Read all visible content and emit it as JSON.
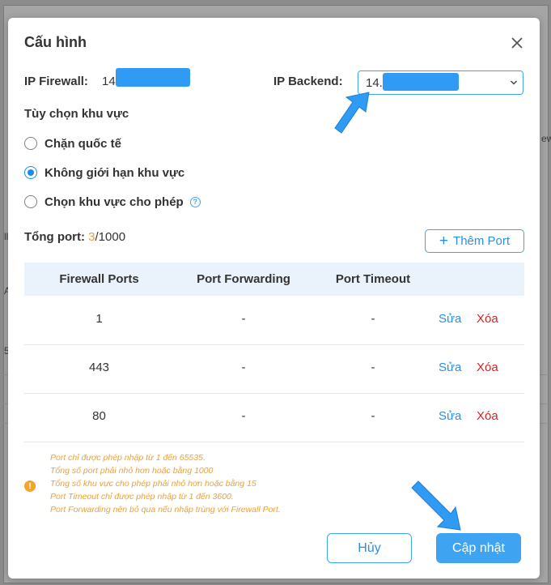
{
  "background": {
    "fragments": [
      "ew",
      "ll",
      "A",
      "5"
    ]
  },
  "modal": {
    "title": "Cấu hình",
    "close_icon": "close-icon"
  },
  "ip": {
    "firewall_label": "IP Firewall:",
    "firewall_value": "14",
    "backend_label": "IP Backend:",
    "backend_value": "14."
  },
  "region": {
    "label": "Tùy chọn khu vực",
    "options": [
      {
        "label": "Chặn quốc tế",
        "checked": false
      },
      {
        "label": "Không giới hạn khu vực",
        "checked": true
      },
      {
        "label": "Chọn khu vực cho phép",
        "checked": false,
        "help": "?"
      }
    ]
  },
  "ports": {
    "total_label": "Tổng port:",
    "current": "3",
    "max": "/1000",
    "add_button": "Thêm Port",
    "columns": [
      "Firewall Ports",
      "Port Forwarding",
      "Port Timeout"
    ],
    "rows": [
      {
        "firewall": "1",
        "forwarding": "-",
        "timeout": "-",
        "edit": "Sửa",
        "delete": "Xóa"
      },
      {
        "firewall": "443",
        "forwarding": "-",
        "timeout": "-",
        "edit": "Sửa",
        "delete": "Xóa"
      },
      {
        "firewall": "80",
        "forwarding": "-",
        "timeout": "-",
        "edit": "Sửa",
        "delete": "Xóa"
      }
    ]
  },
  "notes": {
    "icon": "!",
    "lines": [
      "Port chỉ được phép nhập từ 1 đến 65535.",
      "Tổng số port phải nhỏ hơn hoặc bằng 1000",
      "Tổng số khu vực cho phép phải nhỏ hơn hoặc bằng 15",
      "Port Timeout chỉ được phép nhập từ 1 đến 3600.",
      "Port Forwarding nên bỏ qua nếu nhập trùng với Firewall Port."
    ]
  },
  "footer": {
    "cancel": "Hủy",
    "update": "Cập nhật"
  },
  "colors": {
    "accent": "#3ea4f2",
    "delete": "#e02020",
    "warning": "#f0a030"
  }
}
